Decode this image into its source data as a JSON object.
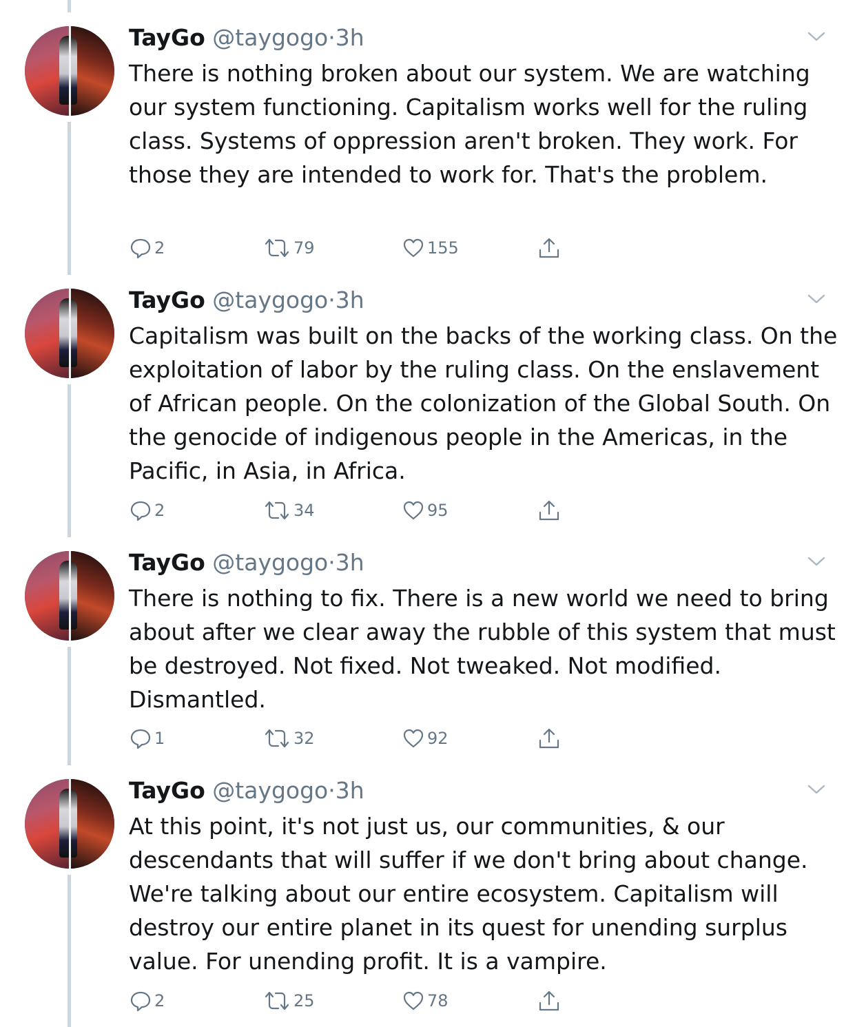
{
  "tweets": [
    {
      "name": "TayGo",
      "handle": "@taygogo",
      "separator": "·",
      "time": "3h",
      "text": "There is nothing broken about our system. We are watching our system functioning. Capitalism works well for the ruling class. Systems of oppression aren't broken. They work. For those they are intended to work for. That's the problem.",
      "replies": "2",
      "retweets": "79",
      "likes": "155"
    },
    {
      "name": "TayGo",
      "handle": "@taygogo",
      "separator": "·",
      "time": "3h",
      "text": "Capitalism was built on the backs of the working class. On the exploitation of labor by the ruling class. On the enslavement of African people. On the colonization of the Global South. On the genocide of indigenous people in the Americas, in the Pacific, in Asia, in Africa.",
      "replies": "2",
      "retweets": "34",
      "likes": "95"
    },
    {
      "name": "TayGo",
      "handle": "@taygogo",
      "separator": "·",
      "time": "3h",
      "text": "There is nothing to fix. There is a new world we need to bring about after we clear away the rubble of this system that must be destroyed. Not fixed. Not tweaked. Not modified. Dismantled.",
      "replies": "1",
      "retweets": "32",
      "likes": "92"
    },
    {
      "name": "TayGo",
      "handle": "@taygogo",
      "separator": "·",
      "time": "3h",
      "text": "At this point, it's not just us, our communities, & our descendants that will suffer if we don't bring about change. We're talking about our entire ecosystem. Capitalism will destroy our entire planet in its quest for unending surplus value. For unending profit. It is a vampire.",
      "replies": "2",
      "retweets": "25",
      "likes": "78"
    }
  ],
  "icons": {
    "reply": "reply-icon",
    "retweet": "retweet-icon",
    "like": "heart-icon",
    "share": "share-icon",
    "menu": "chevron-down-icon"
  },
  "colors": {
    "text": "#14171a",
    "secondary": "#657786",
    "thread_line": "#cdd6dd",
    "background": "#ffffff"
  }
}
